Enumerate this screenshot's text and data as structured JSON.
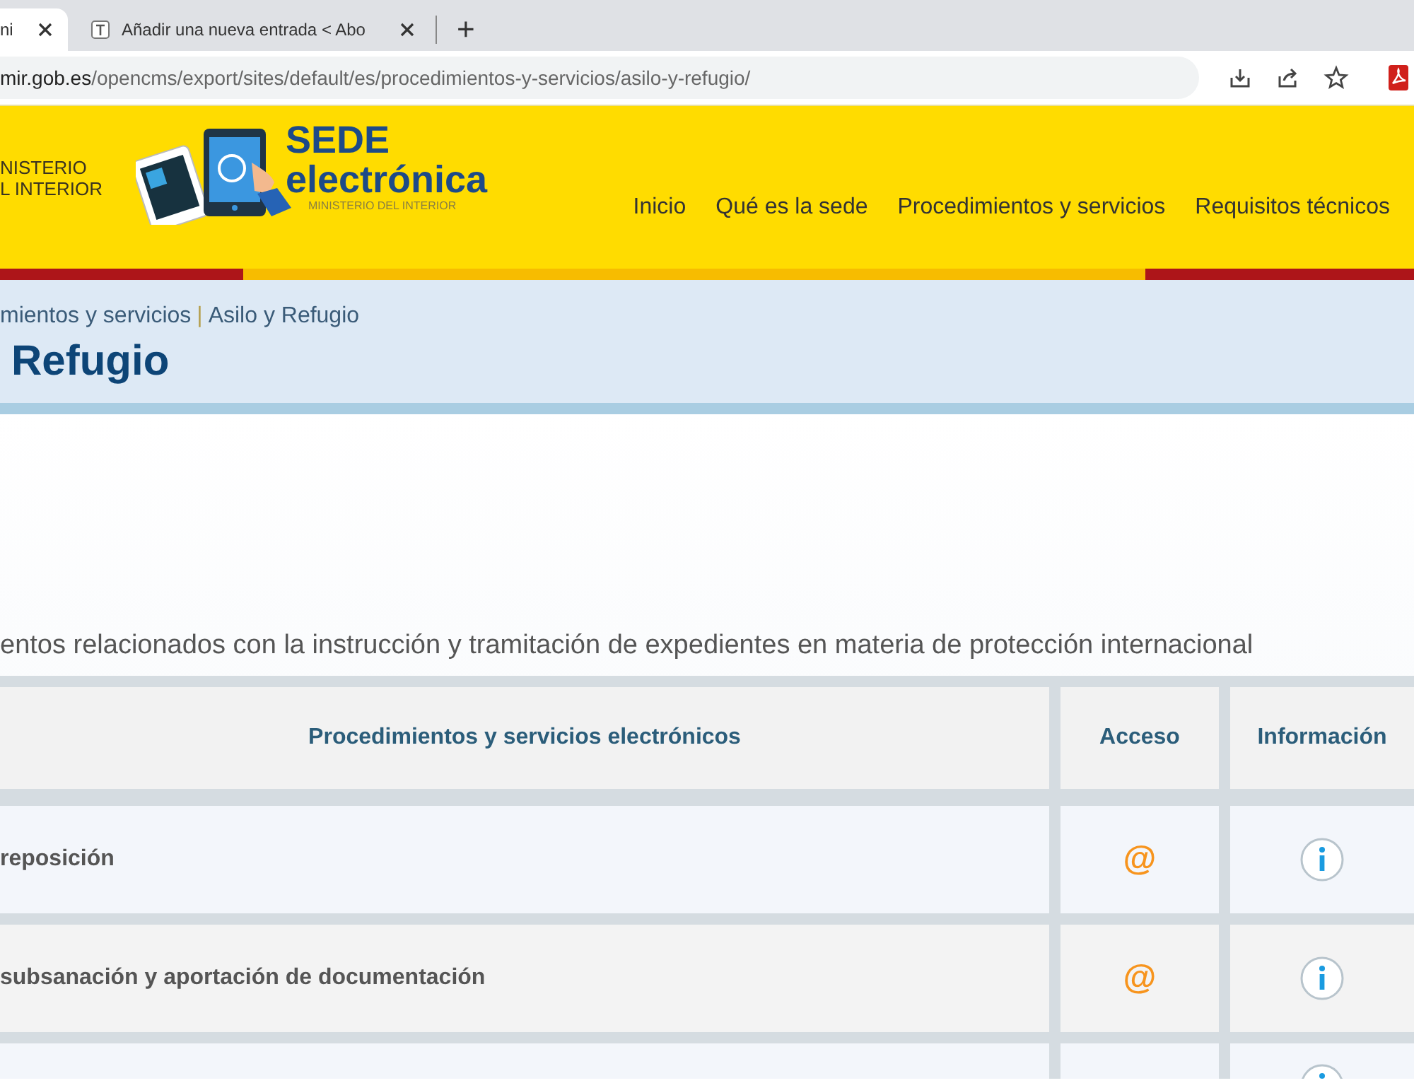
{
  "browser": {
    "tabs": [
      {
        "label": "ni",
        "selected": true
      },
      {
        "label": "Añadir una nueva entrada < Abo",
        "selected": false
      }
    ],
    "new_tab": "+",
    "url": "**mir.gob.es**/opencms/export/sites/default/es/procedimientos-y-servicios/asilo-y-refugio/"
  },
  "header": {
    "ministry_lines": [
      "NISTERIO",
      "L INTERIOR"
    ],
    "logo_title": "SEDE",
    "logo_subtitle": "electrónica",
    "logo_caption": "MINISTERIO DEL INTERIOR",
    "nav": [
      "Inicio",
      "Qué es la sede",
      "Procedimientos y servicios",
      "Requisitos técnicos"
    ]
  },
  "breadcrumb": [
    "mientos y servicios",
    "Asilo y Refugio"
  ],
  "breadcrumb_separator": "|",
  "page_title": "Refugio",
  "intro": "entos relacionados con la instrucción y tramitación de expedientes en materia de protección internacional",
  "table": {
    "columns": [
      "Procedimientos y servicios electrónicos",
      "Acceso",
      "Información"
    ],
    "rows": [
      {
        "title": "reposición",
        "access": "@",
        "info": true
      },
      {
        "title": "subsanación y aportación de documentación",
        "access": "@",
        "info": true
      },
      {
        "info": true
      }
    ]
  }
}
